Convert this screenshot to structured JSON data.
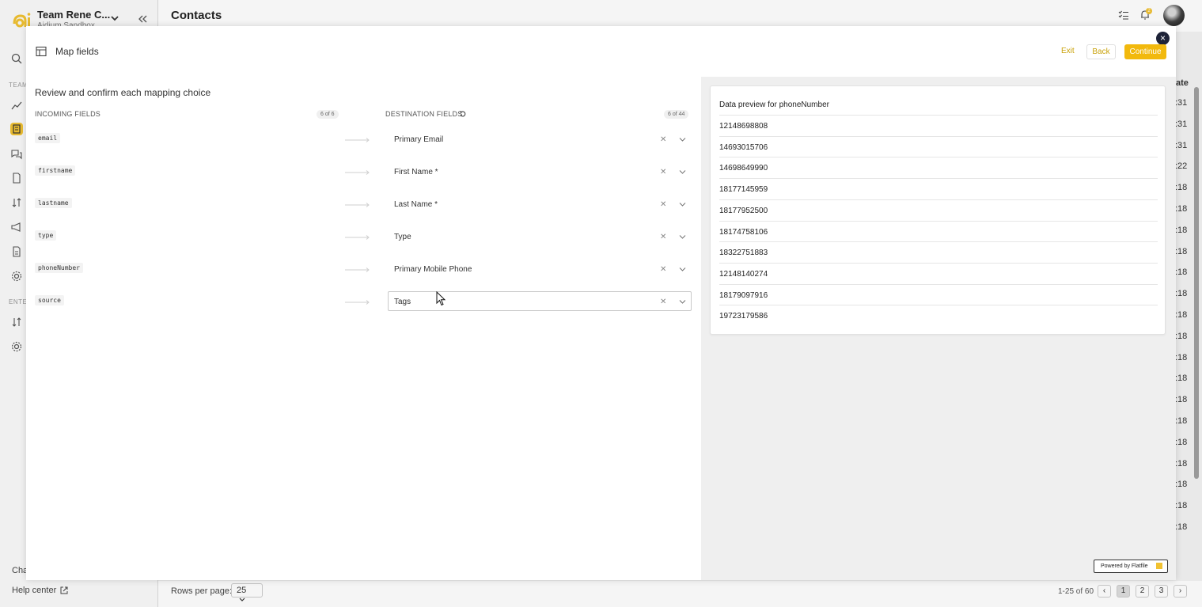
{
  "app": {
    "team_name": "Team Rene C...",
    "team_sub": "Aidium Sandbox",
    "page_title": "Contacts",
    "sidebar_sections": [
      "TEAM",
      "ENTE"
    ],
    "chat_label": "Chat",
    "help_center": "Help center",
    "notification_count": "2",
    "accent_color": "#f1c232",
    "icons": [
      "search-icon",
      "chart-icon",
      "contacts-icon",
      "chat-icon",
      "document-icon",
      "sort-icon",
      "megaphone-icon",
      "file-icon",
      "gear-icon"
    ]
  },
  "background_table": {
    "header_fragment": "ate",
    "times": [
      ":31",
      ":31",
      ":31",
      ":22",
      ":18",
      ":18",
      ":18",
      ":18",
      ":18",
      ":18",
      ":18",
      ":18",
      ":18",
      ":18",
      ":18",
      ":18",
      ":18",
      ":18",
      ":18",
      ":18",
      ":18"
    ]
  },
  "footer": {
    "rows_per_page_label": "Rows per page:",
    "rows_per_page_value": "25",
    "range": "1-25 of 60",
    "pages": [
      "1",
      "2",
      "3"
    ],
    "active_page": "1"
  },
  "modal": {
    "title": "Map fields",
    "exit_label": "Exit",
    "back_label": "Back",
    "continue_label": "Continue",
    "close_label": "×",
    "heading": "Review and confirm each mapping choice",
    "incoming_header": "INCOMING FIELDS",
    "incoming_count": "6 of 6",
    "destination_header": "DESTINATION FIELDS",
    "destination_count": "6 of 44",
    "mappings": [
      {
        "source": "email",
        "destination": "Primary Email"
      },
      {
        "source": "firstname",
        "destination": "First Name *"
      },
      {
        "source": "lastname",
        "destination": "Last Name *"
      },
      {
        "source": "type",
        "destination": "Type"
      },
      {
        "source": "phoneNumber",
        "destination": "Primary Mobile Phone"
      },
      {
        "source": "source",
        "destination": "Tags"
      }
    ],
    "clear_label": "✕",
    "preview": {
      "title": "Data preview for phoneNumber",
      "values": [
        "12148698808",
        "14693015706",
        "14698649990",
        "18177145959",
        "18177952500",
        "18174758106",
        "18322751883",
        "12148140274",
        "18179097916",
        "19723179586"
      ]
    },
    "powered_by": "Powered by Flatfile"
  }
}
